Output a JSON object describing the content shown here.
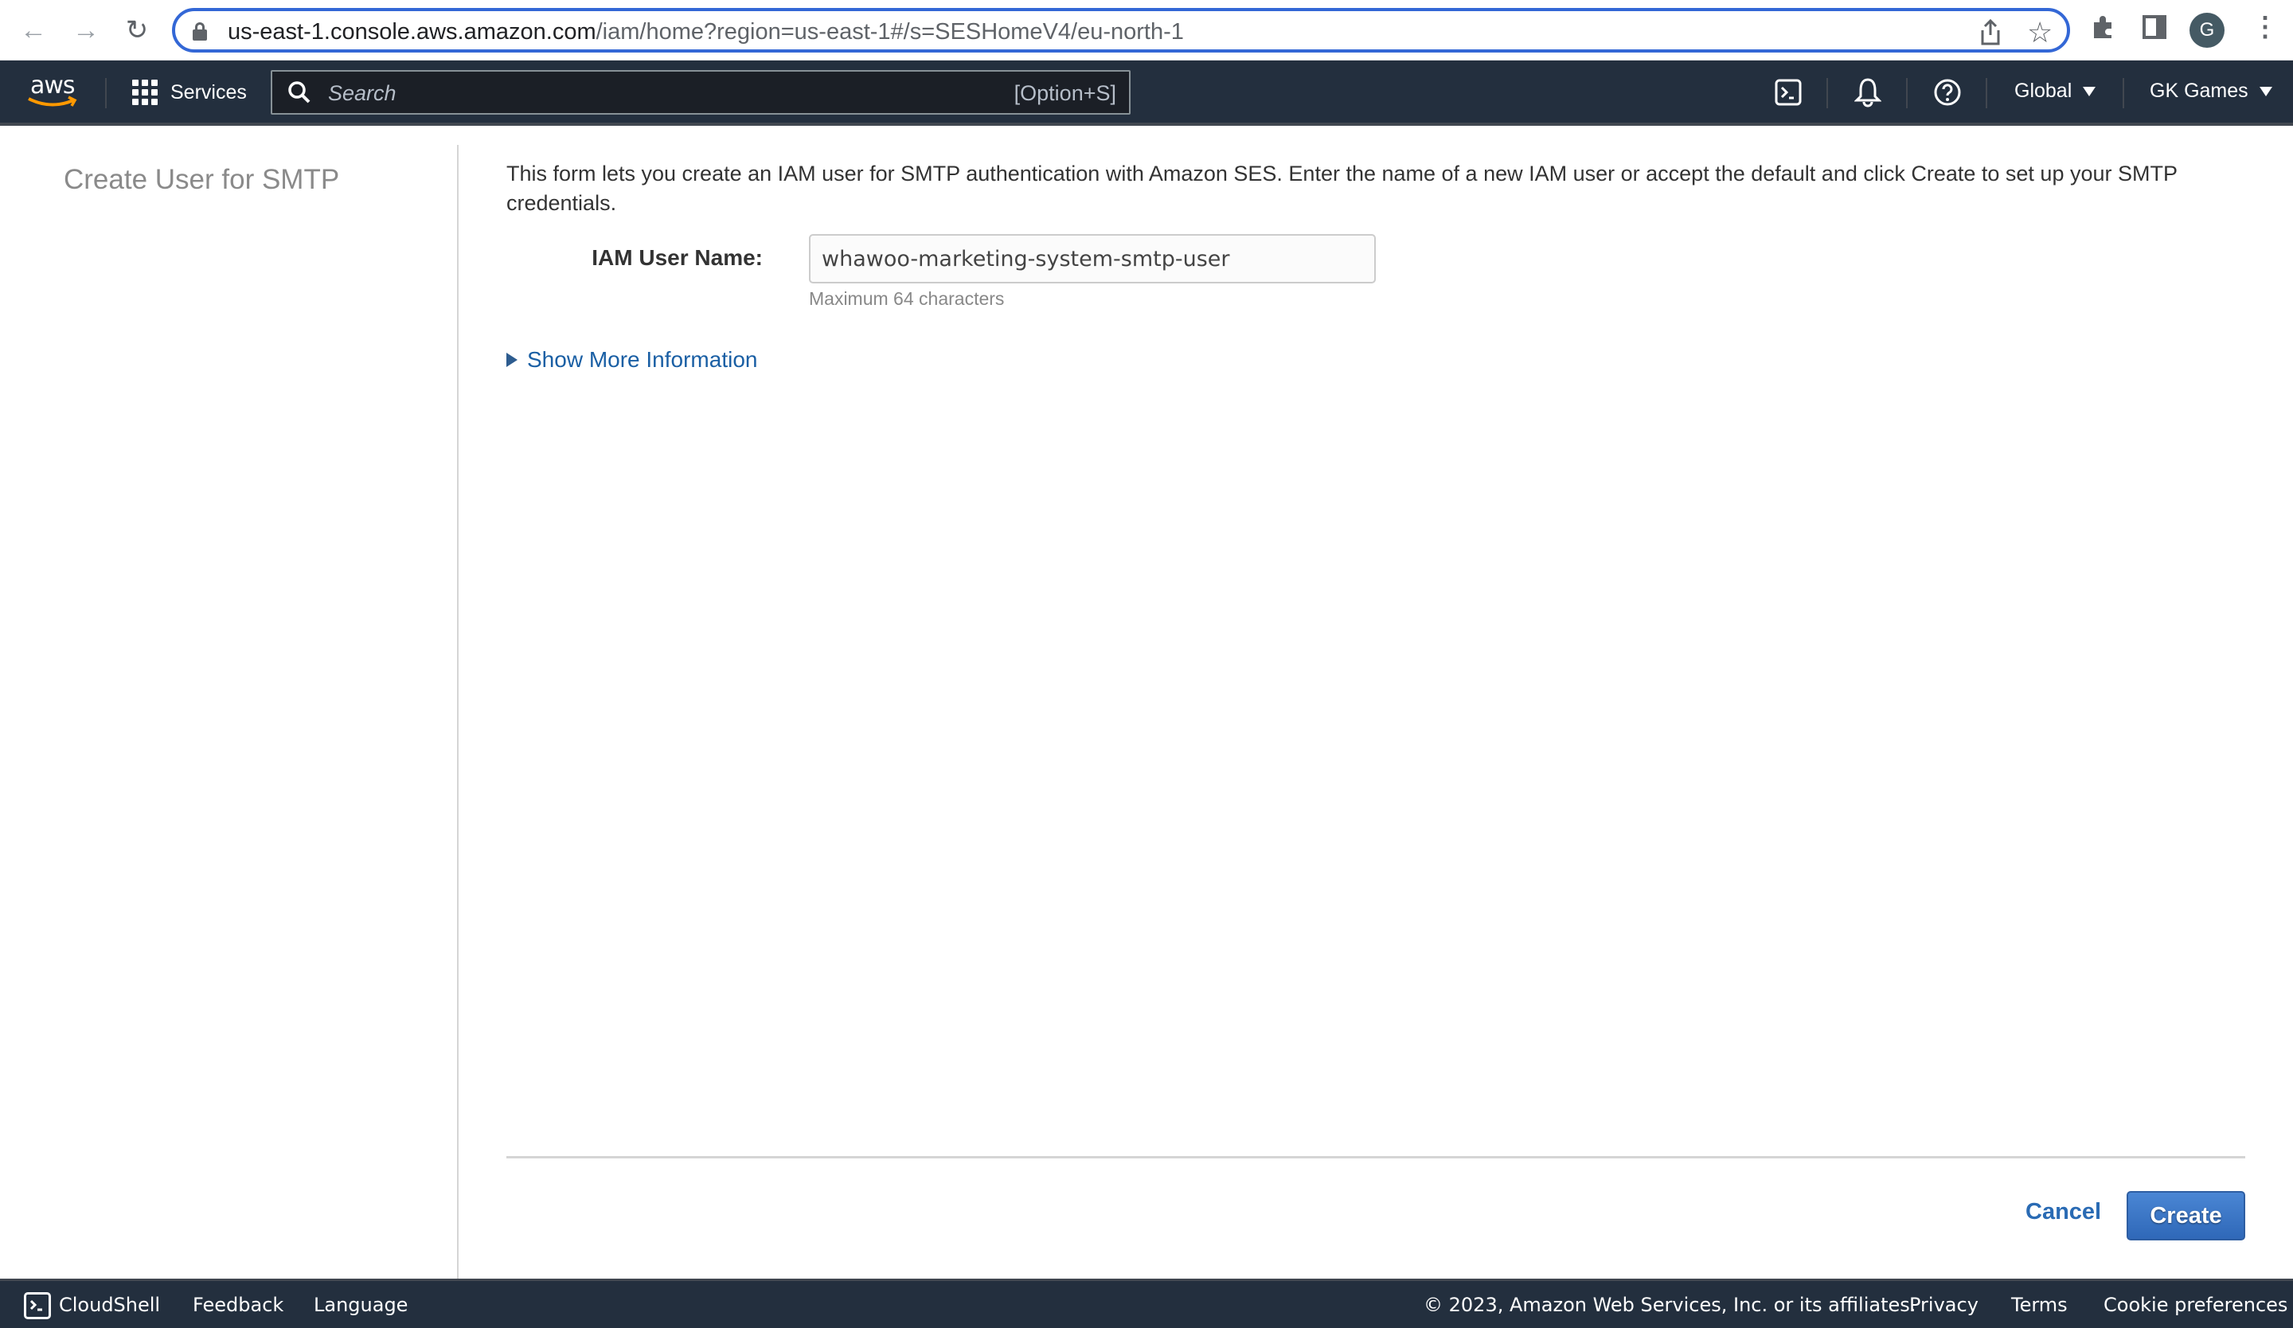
{
  "browser": {
    "url_host": "us-east-1.console.aws.amazon.com",
    "url_path": "/iam/home?region=us-east-1#/s=SESHomeV4/eu-north-1",
    "profile_initial": "G",
    "icons": [
      "back-icon",
      "forward-icon",
      "reload-icon",
      "lock-icon",
      "share-icon",
      "bookmark-star-icon",
      "extensions-icon",
      "side-panel-icon",
      "profile-avatar",
      "more-menu-icon"
    ]
  },
  "aws_nav": {
    "logo_text": "aws",
    "services_label": "Services",
    "search_placeholder": "Search",
    "search_shortcut": "[Option+S]",
    "region_label": "Global",
    "account_label": "GK Games",
    "icons": [
      "cloudshell-icon",
      "notifications-bell-icon",
      "help-icon"
    ]
  },
  "sidebar": {
    "title": "Create User for SMTP"
  },
  "main": {
    "intro": "This form lets you create an IAM user for SMTP authentication with Amazon SES. Enter the name of a new IAM user or accept the default and click Create to set up your SMTP credentials.",
    "field_label": "IAM User Name:",
    "field_value": "whawoo-marketing-system-smtp-user",
    "field_hint": "Maximum 64 characters",
    "show_more_label": "Show More Information",
    "cancel_label": "Cancel",
    "create_label": "Create"
  },
  "footer": {
    "cloudshell_label": "CloudShell",
    "feedback_label": "Feedback",
    "language_label": "Language",
    "copyright": "© 2023, Amazon Web Services, Inc. or its affiliates.",
    "privacy_label": "Privacy",
    "terms_label": "Terms",
    "cookie_label": "Cookie preferences"
  },
  "colors": {
    "aws_nav_bg": "#232f3e",
    "link_blue": "#1a5fa4",
    "primary_button": "#3a75c4",
    "omnibox_focus": "#3367d6"
  }
}
